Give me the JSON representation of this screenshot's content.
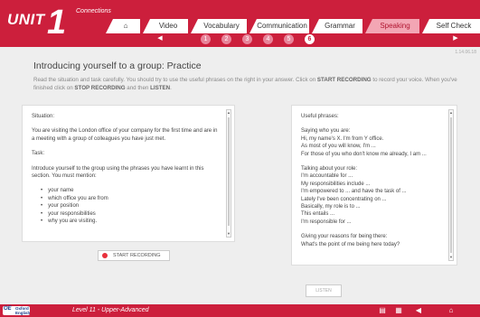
{
  "header": {
    "unit_label": "UNIT",
    "unit_number": "1",
    "section": "Connections",
    "tabs": [
      {
        "label": "⌂",
        "active": false
      },
      {
        "label": "Video",
        "active": false
      },
      {
        "label": "Vocabulary",
        "active": false
      },
      {
        "label": "Communication",
        "active": false
      },
      {
        "label": "Grammar",
        "active": false
      },
      {
        "label": "Speaking",
        "active": true
      },
      {
        "label": "Self Check",
        "active": false
      }
    ],
    "steps": [
      "1",
      "2",
      "3",
      "4",
      "5",
      "6"
    ],
    "active_step": "6",
    "prev_arrow": "◀",
    "next_arrow": "▶"
  },
  "page_counter": "1.14.06.18",
  "title": "Introducing yourself to a group: Practice",
  "instructions": {
    "before1": "Read the situation and task carefully. You should try to use the useful phrases on the right in your answer. Click on ",
    "start_recording": "START RECORDING",
    "after1": " to record your voice. When you've finished click on ",
    "stop_recording": "STOP RECORDING",
    "middle": " and then ",
    "listen": "LISTEN",
    "end": "."
  },
  "left_panel": {
    "situation_heading": "Situation:",
    "situation_text": "You are visiting the London office of your company for the first time and are in a meeting with a group of colleagues you have just met.",
    "task_heading": "Task:",
    "task_text": "Introduce yourself to the group using the phrases you have learnt in this section. You must mention:",
    "bullets": [
      "your name",
      "which office you are from",
      "your position",
      "your responsibilities",
      "why you are visiting."
    ]
  },
  "right_panel": {
    "heading": "Useful phrases:",
    "groups": [
      {
        "lines": [
          "Saying who you are:",
          "Hi, my name's X. I'm from Y office.",
          "As most of you will know, I'm ...",
          "For those of you who don't know me already, I am ..."
        ]
      },
      {
        "lines": [
          "Talking about your role:",
          "I'm accountable for ...",
          "My responsibilities include ...",
          "I'm empowered to ... and have the task of ...",
          "Lately I've been concentrating on ...",
          "Basically, my role is to ...",
          "This entails ...",
          "I'm responsible for ..."
        ]
      },
      {
        "lines": [
          "Giving your reasons for being there:",
          "What's the point of me being here today?"
        ]
      }
    ]
  },
  "buttons": {
    "start_recording": "START RECORDING",
    "listen": "LISTEN"
  },
  "footer": {
    "logo_top": "Oxford",
    "logo_bottom": "English",
    "logo_mark": "OE",
    "level": "Level 11 - Upper-Advanced",
    "icons": [
      "book-icon",
      "document-icon",
      "volume-icon",
      "home-icon"
    ]
  },
  "colors": {
    "brand": "#cc1f3c",
    "active_tab": "#f3a6b4",
    "record_dot": "#e8303c"
  }
}
